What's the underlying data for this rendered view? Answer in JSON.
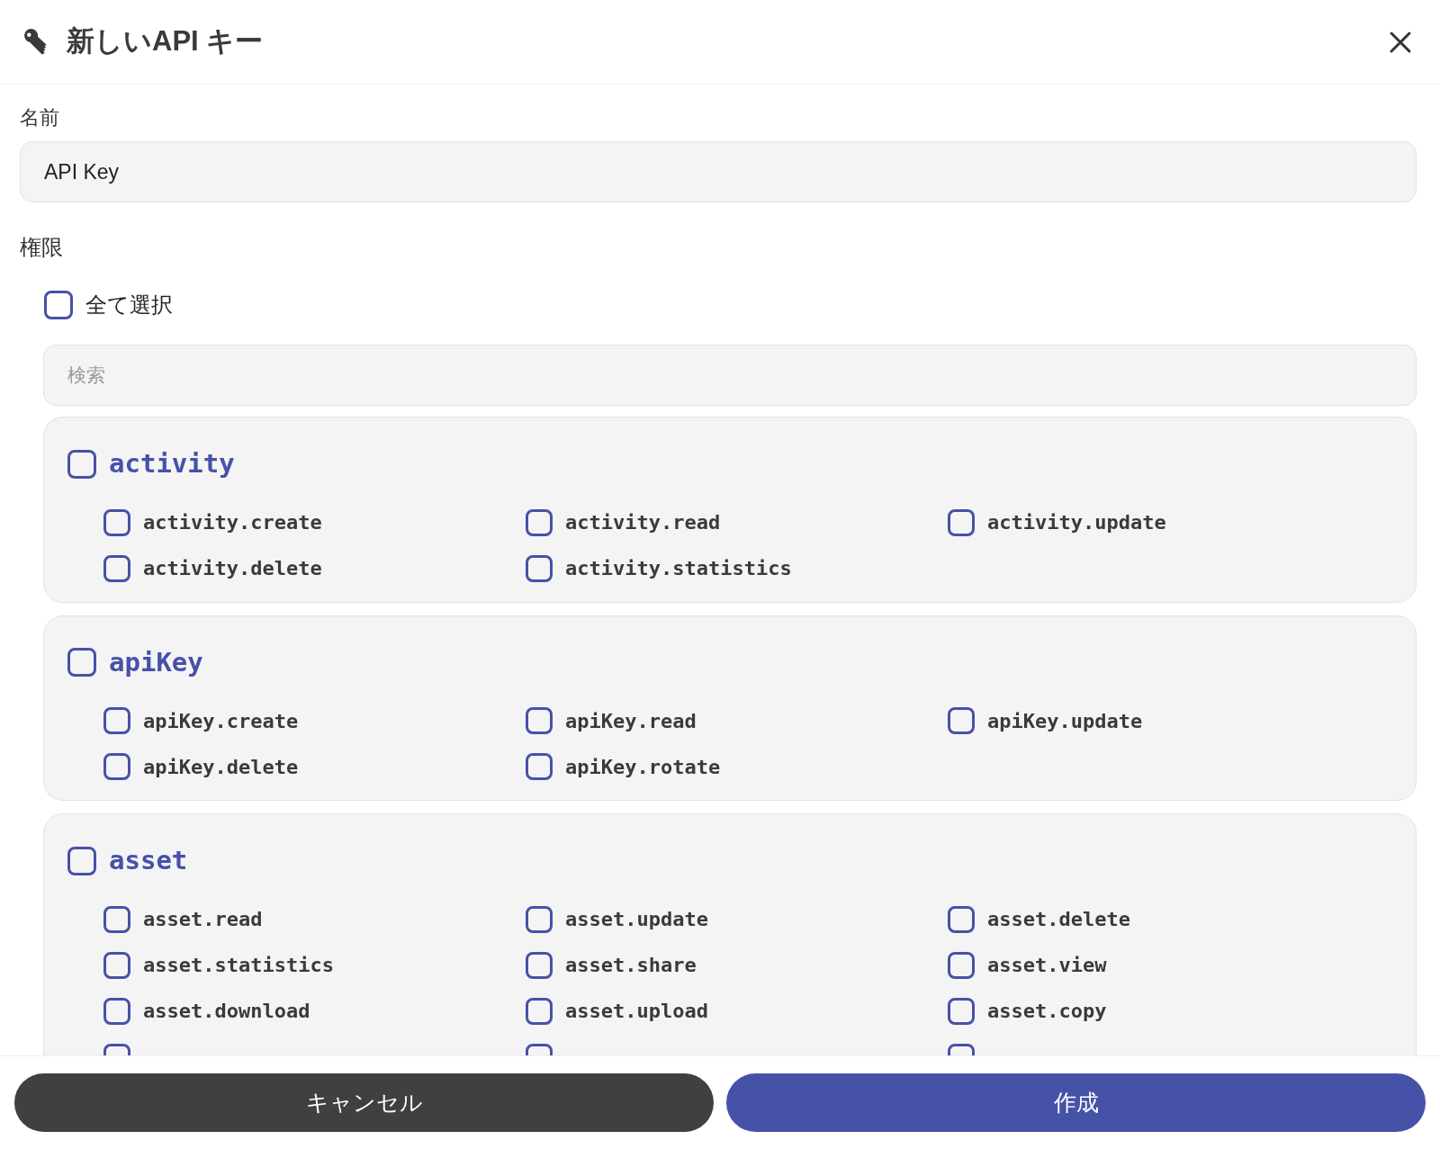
{
  "dialog": {
    "title": "新しいAPI キー"
  },
  "name_field": {
    "label": "名前",
    "value": "API Key"
  },
  "permissions": {
    "label": "権限",
    "select_all": {
      "label": "全て選択",
      "checked": false
    },
    "search": {
      "placeholder": "検索"
    },
    "groups": [
      {
        "name": "activity",
        "checked": false,
        "items": [
          {
            "label": "activity.create",
            "checked": false
          },
          {
            "label": "activity.read",
            "checked": false
          },
          {
            "label": "activity.update",
            "checked": false
          },
          {
            "label": "activity.delete",
            "checked": false
          },
          {
            "label": "activity.statistics",
            "checked": false
          }
        ]
      },
      {
        "name": "apiKey",
        "checked": false,
        "items": [
          {
            "label": "apiKey.create",
            "checked": false
          },
          {
            "label": "apiKey.read",
            "checked": false
          },
          {
            "label": "apiKey.update",
            "checked": false
          },
          {
            "label": "apiKey.delete",
            "checked": false
          },
          {
            "label": "apiKey.rotate",
            "checked": false
          }
        ]
      },
      {
        "name": "asset",
        "checked": false,
        "items": [
          {
            "label": "asset.read",
            "checked": false
          },
          {
            "label": "asset.update",
            "checked": false
          },
          {
            "label": "asset.delete",
            "checked": false
          },
          {
            "label": "asset.statistics",
            "checked": false
          },
          {
            "label": "asset.share",
            "checked": false
          },
          {
            "label": "asset.view",
            "checked": false
          },
          {
            "label": "asset.download",
            "checked": false
          },
          {
            "label": "asset.upload",
            "checked": false
          },
          {
            "label": "asset.copy",
            "checked": false
          },
          {
            "checked": false
          },
          {
            "checked": false
          },
          {
            "checked": false
          }
        ]
      }
    ]
  },
  "buttons": {
    "cancel": "キャンセル",
    "create": "作成"
  }
}
